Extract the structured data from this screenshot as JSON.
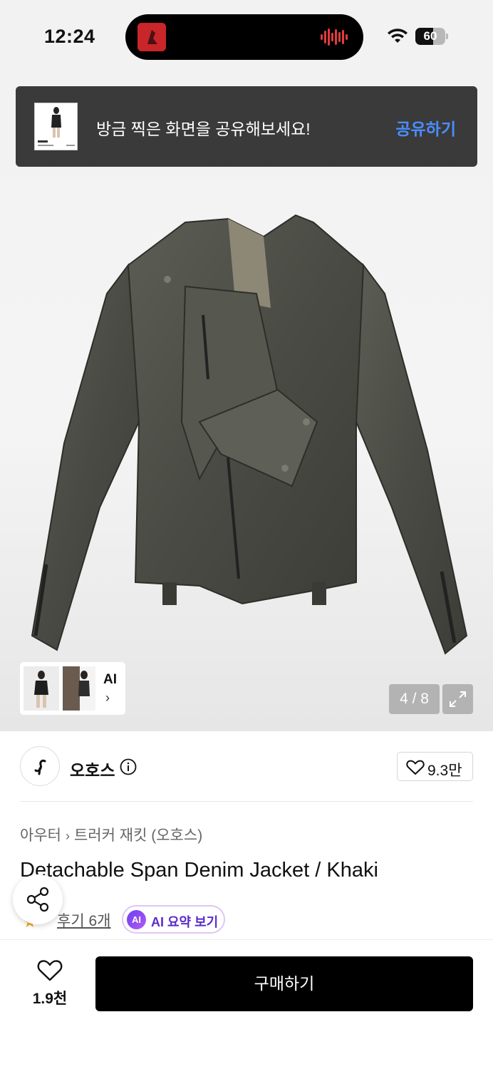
{
  "status": {
    "time": "12:24",
    "battery": "60",
    "battery_level": 0.6
  },
  "share_banner": {
    "message": "방금 찍은 화면을 공유해보세요!",
    "action": "공유하기"
  },
  "gallery": {
    "thumb_ai_label": "AI",
    "thumb_chevron": "›",
    "page_counter": "4 / 8"
  },
  "brand": {
    "name": "오호스",
    "like_count": "9.3만"
  },
  "product": {
    "breadcrumb": [
      "아우터",
      "트러커 재킷 (오호스)"
    ],
    "breadcrumb_sep": "›",
    "title": "Detachable Span Denim Jacket / Khaki",
    "review_link": "후기 6개",
    "ai_badge": "AI",
    "ai_summary_label": "AI 요약 보기"
  },
  "bottom": {
    "wish_count": "1.9천",
    "buy_label": "구매하기"
  },
  "colors": {
    "accent_link": "#4a8dff",
    "buy_button": "#000000",
    "banner_bg": "#3a3a3a",
    "ai_purple": "#5b2bc9"
  },
  "icons": {
    "banner_thumb": "product-screenshot-thumbnail",
    "island": "music-album-art",
    "waveform": "audio-waveform-icon",
    "expand": "expand-icon",
    "info": "info-icon",
    "heart": "heart-icon",
    "share": "share-icon",
    "star": "star-icon"
  }
}
